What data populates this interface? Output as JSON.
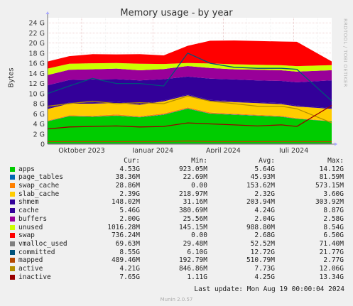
{
  "title": "Memory usage - by year",
  "side_label": "RRDTOOL / TOBI OETIKER",
  "y_label": "Bytes",
  "munin_version": "Munin 2.0.57",
  "last_update": "Last update: Mon Aug 19 00:00:04 2024",
  "legend_headers": [
    "Cur:",
    "Min:",
    "Avg:",
    "Max:"
  ],
  "legend": [
    {
      "name": "apps",
      "color": "#00cc00",
      "cur": "4.53G",
      "min": "923.05M",
      "avg": "5.64G",
      "max": "14.12G"
    },
    {
      "name": "page_tables",
      "color": "#0066b3",
      "cur": "38.36M",
      "min": "22.69M",
      "avg": "45.93M",
      "max": "81.59M"
    },
    {
      "name": "swap_cache",
      "color": "#ff8000",
      "cur": "28.86M",
      "min": "0.00",
      "avg": "153.62M",
      "max": "573.15M"
    },
    {
      "name": "slab_cache",
      "color": "#ffcc00",
      "cur": "2.39G",
      "min": "218.97M",
      "avg": "2.32G",
      "max": "3.60G"
    },
    {
      "name": "shmem",
      "color": "#330099",
      "cur": "148.02M",
      "min": "31.16M",
      "avg": "203.94M",
      "max": "303.92M"
    },
    {
      "name": "cache",
      "color": "#330099",
      "cur": "5.46G",
      "min": "380.69M",
      "avg": "4.24G",
      "max": "8.87G"
    },
    {
      "name": "buffers",
      "color": "#990099",
      "cur": "2.00G",
      "min": "25.56M",
      "avg": "2.04G",
      "max": "2.58G"
    },
    {
      "name": "unused",
      "color": "#ccff00",
      "cur": "1016.28M",
      "min": "145.15M",
      "avg": "988.80M",
      "max": "8.54G"
    },
    {
      "name": "swap",
      "color": "#ff0000",
      "cur": "736.24M",
      "min": "0.00",
      "avg": "2.68G",
      "max": "6.50G"
    },
    {
      "name": "vmalloc_used",
      "color": "#808080",
      "cur": "69.63M",
      "min": "29.48M",
      "avg": "52.52M",
      "max": "71.40M"
    },
    {
      "name": "committed",
      "color": "#00527a",
      "cur": "8.55G",
      "min": "6.10G",
      "avg": "12.72G",
      "max": "21.77G"
    },
    {
      "name": "mapped",
      "color": "#b34700",
      "cur": "489.46M",
      "min": "192.79M",
      "avg": "510.79M",
      "max": "2.77G"
    },
    {
      "name": "active",
      "color": "#b38f00",
      "cur": "4.21G",
      "min": "846.86M",
      "avg": "7.73G",
      "max": "12.06G"
    },
    {
      "name": "inactive",
      "color": "#990000",
      "cur": "7.65G",
      "min": "1.11G",
      "avg": "4.25G",
      "max": "13.34G"
    }
  ],
  "chart_data": {
    "type": "area",
    "title": "Memory usage - by year",
    "ylabel": "Bytes",
    "y_unit": "G",
    "ylim": [
      0,
      25
    ],
    "y_ticks": [
      "0",
      "2 G",
      "4 G",
      "6 G",
      "8 G",
      "10 G",
      "12 G",
      "14 G",
      "16 G",
      "18 G",
      "20 G",
      "22 G",
      "24 G"
    ],
    "x_tick_labels": [
      "Oktober 2023",
      "Januar 2024",
      "April 2024",
      "Juli 2024"
    ],
    "x_range": [
      "2023-08-18",
      "2024-08-19"
    ],
    "x_ticks": [
      "2023-10-01",
      "2024-01-01",
      "2024-04-01",
      "2024-07-01"
    ],
    "grid": true,
    "x": [
      "2023-08-18",
      "2023-09-15",
      "2023-10-15",
      "2023-11-15",
      "2023-12-15",
      "2024-01-15",
      "2024-02-15",
      "2024-03-15",
      "2024-04-15",
      "2024-05-15",
      "2024-06-15",
      "2024-07-05",
      "2024-08-19"
    ],
    "stacked_series": [
      {
        "name": "apps",
        "values": [
          4.5,
          5.5,
          5.4,
          5.6,
          5.3,
          5.8,
          7.0,
          6.0,
          5.8,
          5.6,
          5.4,
          5.0,
          4.5
        ]
      },
      {
        "name": "page_tables",
        "values": [
          0.05,
          0.05,
          0.05,
          0.05,
          0.05,
          0.05,
          0.05,
          0.05,
          0.05,
          0.05,
          0.05,
          0.04,
          0.04
        ]
      },
      {
        "name": "swap_cache",
        "values": [
          0.1,
          0.15,
          0.15,
          0.2,
          0.15,
          0.2,
          0.2,
          0.2,
          0.15,
          0.15,
          0.15,
          0.1,
          0.03
        ]
      },
      {
        "name": "slab_cache",
        "values": [
          2.3,
          2.3,
          2.4,
          2.3,
          2.3,
          2.4,
          2.4,
          2.3,
          2.3,
          2.3,
          2.3,
          2.3,
          2.4
        ]
      },
      {
        "name": "shmem",
        "values": [
          0.2,
          0.2,
          0.2,
          0.2,
          0.2,
          0.2,
          0.2,
          0.2,
          0.2,
          0.2,
          0.2,
          0.2,
          0.15
        ]
      },
      {
        "name": "cache",
        "values": [
          4.5,
          4.5,
          4.6,
          4.5,
          4.6,
          4.2,
          3.5,
          4.2,
          4.3,
          4.3,
          4.4,
          4.6,
          5.5
        ]
      },
      {
        "name": "buffers",
        "values": [
          2.0,
          2.0,
          2.0,
          2.1,
          2.0,
          2.0,
          2.1,
          2.1,
          2.0,
          2.1,
          2.1,
          2.1,
          2.0
        ]
      },
      {
        "name": "unused",
        "values": [
          1.3,
          1.2,
          1.2,
          1.1,
          1.3,
          1.0,
          0.6,
          0.9,
          1.0,
          1.0,
          1.0,
          1.1,
          1.0
        ]
      },
      {
        "name": "swap",
        "values": [
          1.4,
          1.5,
          1.8,
          1.7,
          1.9,
          1.7,
          3.4,
          4.5,
          4.7,
          4.7,
          4.7,
          4.8,
          0.74
        ]
      }
    ],
    "line_series": [
      {
        "name": "vmalloc_used",
        "values": [
          0.05,
          0.05,
          0.05,
          0.05,
          0.05,
          0.05,
          0.06,
          0.06,
          0.06,
          0.06,
          0.06,
          0.06,
          0.07
        ]
      },
      {
        "name": "committed",
        "values": [
          10.0,
          11.5,
          13.0,
          12.0,
          12.0,
          11.5,
          18.0,
          16.0,
          15.2,
          15.0,
          15.0,
          14.8,
          8.55
        ]
      },
      {
        "name": "mapped",
        "values": [
          0.5,
          0.5,
          0.5,
          0.5,
          0.5,
          0.5,
          0.6,
          0.5,
          0.5,
          0.5,
          0.5,
          0.5,
          0.49
        ]
      },
      {
        "name": "active",
        "values": [
          7.5,
          8.0,
          8.5,
          8.0,
          8.2,
          8.0,
          9.5,
          8.5,
          8.0,
          7.5,
          7.5,
          7.0,
          4.21
        ]
      },
      {
        "name": "inactive",
        "values": [
          3.0,
          3.4,
          3.5,
          3.6,
          3.4,
          3.5,
          4.2,
          4.0,
          3.8,
          3.6,
          3.8,
          3.5,
          7.65
        ]
      }
    ]
  }
}
